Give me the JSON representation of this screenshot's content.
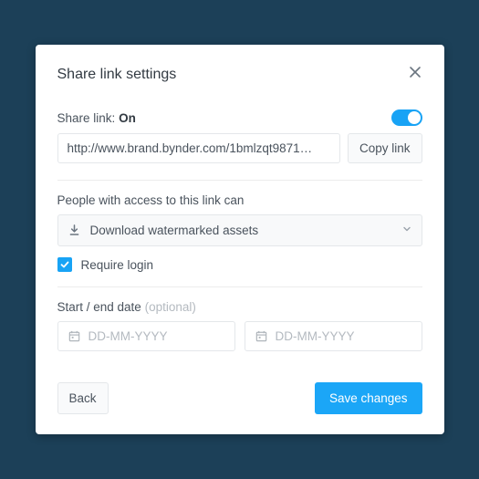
{
  "modal": {
    "title": "Share link settings",
    "shareLink": {
      "label": "Share link:",
      "status": "On",
      "url": "http://www.brand.bynder.com/1bmlzqt9871…",
      "copyLabel": "Copy link"
    },
    "permissions": {
      "label": "People with access to this link can",
      "selected": "Download watermarked assets"
    },
    "requireLogin": {
      "checked": true,
      "label": "Require login"
    },
    "dates": {
      "label": "Start / end date",
      "optional": "(optional)",
      "startPlaceholder": "DD-MM-YYYY",
      "endPlaceholder": "DD-MM-YYYY"
    },
    "footer": {
      "back": "Back",
      "save": "Save changes"
    }
  }
}
